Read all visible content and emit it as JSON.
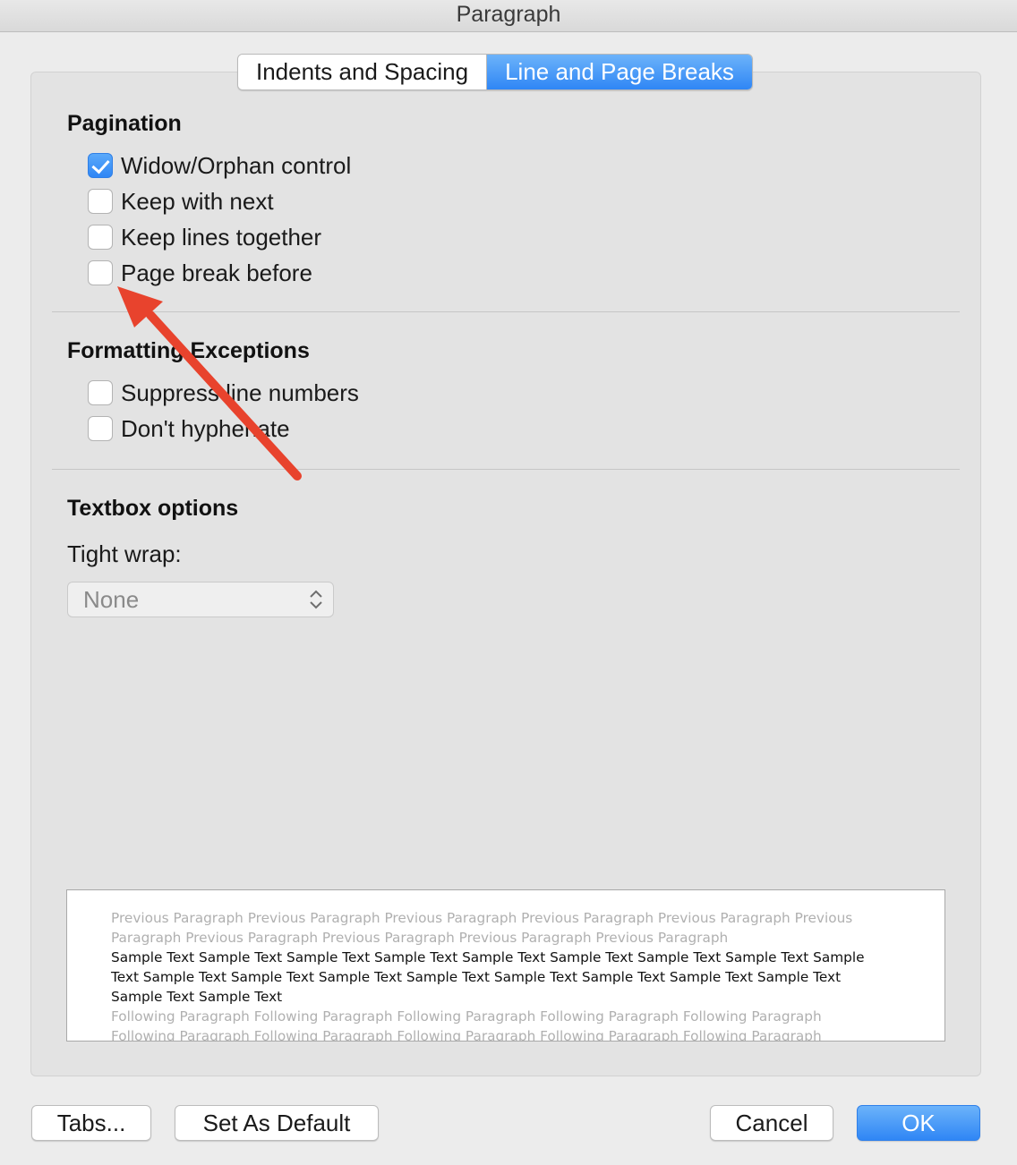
{
  "window": {
    "title": "Paragraph"
  },
  "tabs": [
    {
      "label": "Indents and Spacing",
      "active": false
    },
    {
      "label": "Line and Page Breaks",
      "active": true
    }
  ],
  "pagination": {
    "title": "Pagination",
    "options": [
      {
        "label": "Widow/Orphan control",
        "checked": true
      },
      {
        "label": "Keep with next",
        "checked": false
      },
      {
        "label": "Keep lines together",
        "checked": false
      },
      {
        "label": "Page break before",
        "checked": false
      }
    ]
  },
  "formatting_exceptions": {
    "title": "Formatting Exceptions",
    "options": [
      {
        "label": "Suppress line numbers",
        "checked": false
      },
      {
        "label": "Don't hyphenate",
        "checked": false
      }
    ]
  },
  "textbox_options": {
    "title": "Textbox options",
    "tight_wrap_label": "Tight wrap:",
    "tight_wrap_value": "None"
  },
  "preview": {
    "previous": "Previous Paragraph Previous Paragraph Previous Paragraph Previous Paragraph Previous Paragraph Previous Paragraph Previous Paragraph Previous Paragraph Previous Paragraph Previous Paragraph",
    "sample": "Sample Text Sample Text Sample Text Sample Text Sample Text Sample Text Sample Text Sample Text Sample Text Sample Text Sample Text Sample Text Sample Text Sample Text Sample Text Sample Text Sample Text Sample Text Sample Text",
    "following": "Following Paragraph Following Paragraph Following Paragraph Following Paragraph Following Paragraph Following Paragraph Following Paragraph Following Paragraph Following Paragraph Following Paragraph Following Paragraph"
  },
  "buttons": {
    "tabs": "Tabs...",
    "set_default": "Set As Default",
    "cancel": "Cancel",
    "ok": "OK"
  },
  "colors": {
    "accent": "#2f86f5",
    "annotation_arrow": "#e8432d",
    "panel": "#e3e3e3"
  }
}
